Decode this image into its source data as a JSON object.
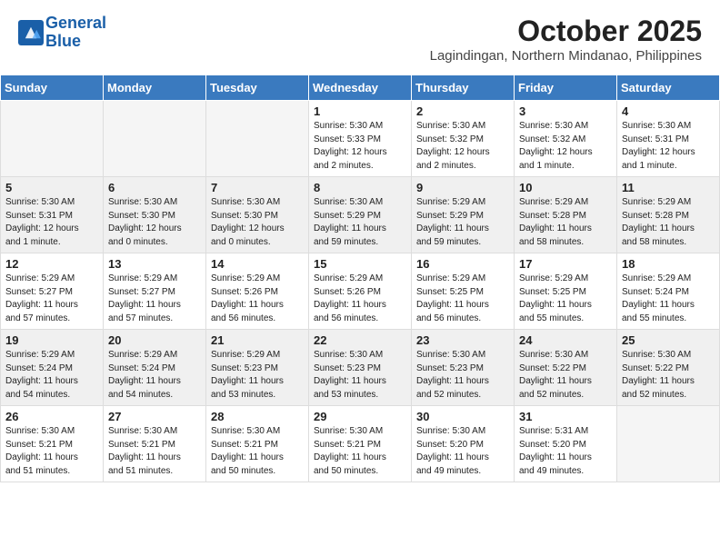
{
  "header": {
    "logo_line1": "General",
    "logo_line2": "Blue",
    "month": "October 2025",
    "location": "Lagindingan, Northern Mindanao, Philippines"
  },
  "weekdays": [
    "Sunday",
    "Monday",
    "Tuesday",
    "Wednesday",
    "Thursday",
    "Friday",
    "Saturday"
  ],
  "weeks": [
    [
      {
        "day": "",
        "info": ""
      },
      {
        "day": "",
        "info": ""
      },
      {
        "day": "",
        "info": ""
      },
      {
        "day": "1",
        "info": "Sunrise: 5:30 AM\nSunset: 5:33 PM\nDaylight: 12 hours\nand 2 minutes."
      },
      {
        "day": "2",
        "info": "Sunrise: 5:30 AM\nSunset: 5:32 PM\nDaylight: 12 hours\nand 2 minutes."
      },
      {
        "day": "3",
        "info": "Sunrise: 5:30 AM\nSunset: 5:32 AM\nDaylight: 12 hours\nand 1 minute."
      },
      {
        "day": "4",
        "info": "Sunrise: 5:30 AM\nSunset: 5:31 PM\nDaylight: 12 hours\nand 1 minute."
      }
    ],
    [
      {
        "day": "5",
        "info": "Sunrise: 5:30 AM\nSunset: 5:31 PM\nDaylight: 12 hours\nand 1 minute."
      },
      {
        "day": "6",
        "info": "Sunrise: 5:30 AM\nSunset: 5:30 PM\nDaylight: 12 hours\nand 0 minutes."
      },
      {
        "day": "7",
        "info": "Sunrise: 5:30 AM\nSunset: 5:30 PM\nDaylight: 12 hours\nand 0 minutes."
      },
      {
        "day": "8",
        "info": "Sunrise: 5:30 AM\nSunset: 5:29 PM\nDaylight: 11 hours\nand 59 minutes."
      },
      {
        "day": "9",
        "info": "Sunrise: 5:29 AM\nSunset: 5:29 PM\nDaylight: 11 hours\nand 59 minutes."
      },
      {
        "day": "10",
        "info": "Sunrise: 5:29 AM\nSunset: 5:28 PM\nDaylight: 11 hours\nand 58 minutes."
      },
      {
        "day": "11",
        "info": "Sunrise: 5:29 AM\nSunset: 5:28 PM\nDaylight: 11 hours\nand 58 minutes."
      }
    ],
    [
      {
        "day": "12",
        "info": "Sunrise: 5:29 AM\nSunset: 5:27 PM\nDaylight: 11 hours\nand 57 minutes."
      },
      {
        "day": "13",
        "info": "Sunrise: 5:29 AM\nSunset: 5:27 PM\nDaylight: 11 hours\nand 57 minutes."
      },
      {
        "day": "14",
        "info": "Sunrise: 5:29 AM\nSunset: 5:26 PM\nDaylight: 11 hours\nand 56 minutes."
      },
      {
        "day": "15",
        "info": "Sunrise: 5:29 AM\nSunset: 5:26 PM\nDaylight: 11 hours\nand 56 minutes."
      },
      {
        "day": "16",
        "info": "Sunrise: 5:29 AM\nSunset: 5:25 PM\nDaylight: 11 hours\nand 56 minutes."
      },
      {
        "day": "17",
        "info": "Sunrise: 5:29 AM\nSunset: 5:25 PM\nDaylight: 11 hours\nand 55 minutes."
      },
      {
        "day": "18",
        "info": "Sunrise: 5:29 AM\nSunset: 5:24 PM\nDaylight: 11 hours\nand 55 minutes."
      }
    ],
    [
      {
        "day": "19",
        "info": "Sunrise: 5:29 AM\nSunset: 5:24 PM\nDaylight: 11 hours\nand 54 minutes."
      },
      {
        "day": "20",
        "info": "Sunrise: 5:29 AM\nSunset: 5:24 PM\nDaylight: 11 hours\nand 54 minutes."
      },
      {
        "day": "21",
        "info": "Sunrise: 5:29 AM\nSunset: 5:23 PM\nDaylight: 11 hours\nand 53 minutes."
      },
      {
        "day": "22",
        "info": "Sunrise: 5:30 AM\nSunset: 5:23 PM\nDaylight: 11 hours\nand 53 minutes."
      },
      {
        "day": "23",
        "info": "Sunrise: 5:30 AM\nSunset: 5:23 PM\nDaylight: 11 hours\nand 52 minutes."
      },
      {
        "day": "24",
        "info": "Sunrise: 5:30 AM\nSunset: 5:22 PM\nDaylight: 11 hours\nand 52 minutes."
      },
      {
        "day": "25",
        "info": "Sunrise: 5:30 AM\nSunset: 5:22 PM\nDaylight: 11 hours\nand 52 minutes."
      }
    ],
    [
      {
        "day": "26",
        "info": "Sunrise: 5:30 AM\nSunset: 5:21 PM\nDaylight: 11 hours\nand 51 minutes."
      },
      {
        "day": "27",
        "info": "Sunrise: 5:30 AM\nSunset: 5:21 PM\nDaylight: 11 hours\nand 51 minutes."
      },
      {
        "day": "28",
        "info": "Sunrise: 5:30 AM\nSunset: 5:21 PM\nDaylight: 11 hours\nand 50 minutes."
      },
      {
        "day": "29",
        "info": "Sunrise: 5:30 AM\nSunset: 5:21 PM\nDaylight: 11 hours\nand 50 minutes."
      },
      {
        "day": "30",
        "info": "Sunrise: 5:30 AM\nSunset: 5:20 PM\nDaylight: 11 hours\nand 49 minutes."
      },
      {
        "day": "31",
        "info": "Sunrise: 5:31 AM\nSunset: 5:20 PM\nDaylight: 11 hours\nand 49 minutes."
      },
      {
        "day": "",
        "info": ""
      }
    ]
  ]
}
